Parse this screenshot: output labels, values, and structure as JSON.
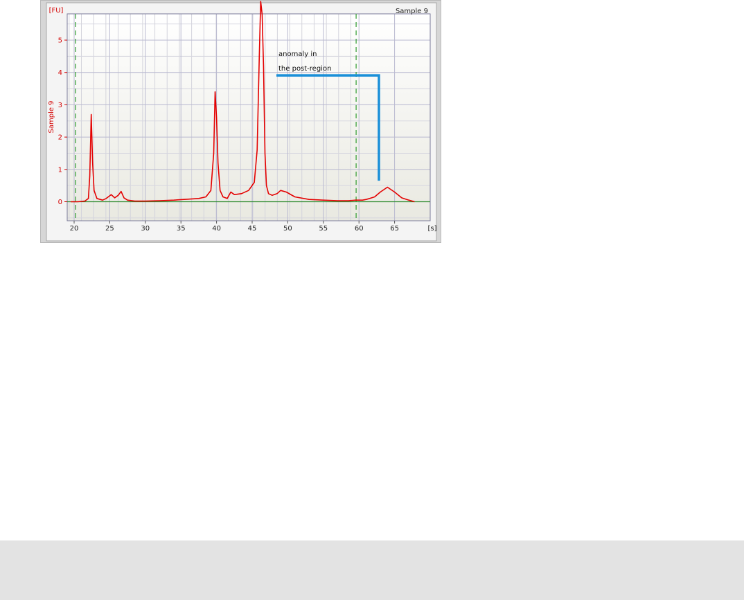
{
  "chart_data": {
    "type": "line",
    "title": "Sample 9",
    "ylabel": "Sample 9",
    "y_unit": "[FU]",
    "x_unit": "[s]",
    "xlim": [
      19.3,
      60.4
    ],
    "ylim": [
      -0.5,
      6.2
    ],
    "x_ticks": [
      "20",
      "25",
      "30",
      "35",
      "40",
      "45",
      "50",
      "55",
      "60",
      "65"
    ],
    "y_ticks": [
      "0",
      "1",
      "2",
      "3",
      "4",
      "5"
    ],
    "marker_lines_x": [
      20.2,
      59.6
    ],
    "series": [
      {
        "color": "#e40000",
        "x": [
          19.5,
          20.5,
          21.5,
          22.0,
          22.2,
          22.4,
          22.6,
          22.8,
          23.2,
          24.0,
          24.5,
          25.2,
          25.7,
          26.2,
          26.6,
          27.0,
          27.5,
          28.5,
          30.0,
          32.0,
          34.0,
          36.0,
          37.5,
          38.5,
          39.2,
          39.6,
          39.8,
          40.0,
          40.2,
          40.5,
          40.9,
          41.5,
          42.0,
          42.5,
          43.5,
          44.5,
          45.3,
          45.7,
          46.0,
          46.2,
          46.4,
          46.6,
          46.8,
          47.0,
          47.3,
          47.8,
          48.5,
          49.0,
          49.8,
          51.0,
          53.0,
          55.0,
          57.0,
          58.5,
          59.5,
          60.2,
          60.5,
          61.0,
          61.5,
          62.2,
          63.0,
          64.0,
          65.0,
          66.0,
          67.0,
          67.8
        ],
        "y": [
          0.0,
          0.0,
          0.02,
          0.1,
          0.8,
          2.7,
          1.2,
          0.35,
          0.1,
          0.05,
          0.1,
          0.22,
          0.12,
          0.2,
          0.32,
          0.12,
          0.05,
          0.02,
          0.02,
          0.03,
          0.05,
          0.08,
          0.1,
          0.15,
          0.35,
          1.5,
          3.4,
          2.6,
          1.2,
          0.35,
          0.15,
          0.1,
          0.3,
          0.22,
          0.25,
          0.35,
          0.6,
          1.6,
          4.5,
          6.2,
          5.8,
          4.2,
          1.5,
          0.5,
          0.25,
          0.2,
          0.25,
          0.35,
          0.3,
          0.15,
          0.07,
          0.05,
          0.03,
          0.03,
          0.05,
          0.05,
          0.05,
          0.07,
          0.1,
          0.15,
          0.3,
          0.45,
          0.3,
          0.12,
          0.05,
          0.0
        ]
      }
    ],
    "annotations": [
      {
        "lines": [
          "anomaly in",
          "the post-region"
        ],
        "target_x": 62.8,
        "target_y": 0.65,
        "color": "#1a8fd8"
      }
    ]
  }
}
